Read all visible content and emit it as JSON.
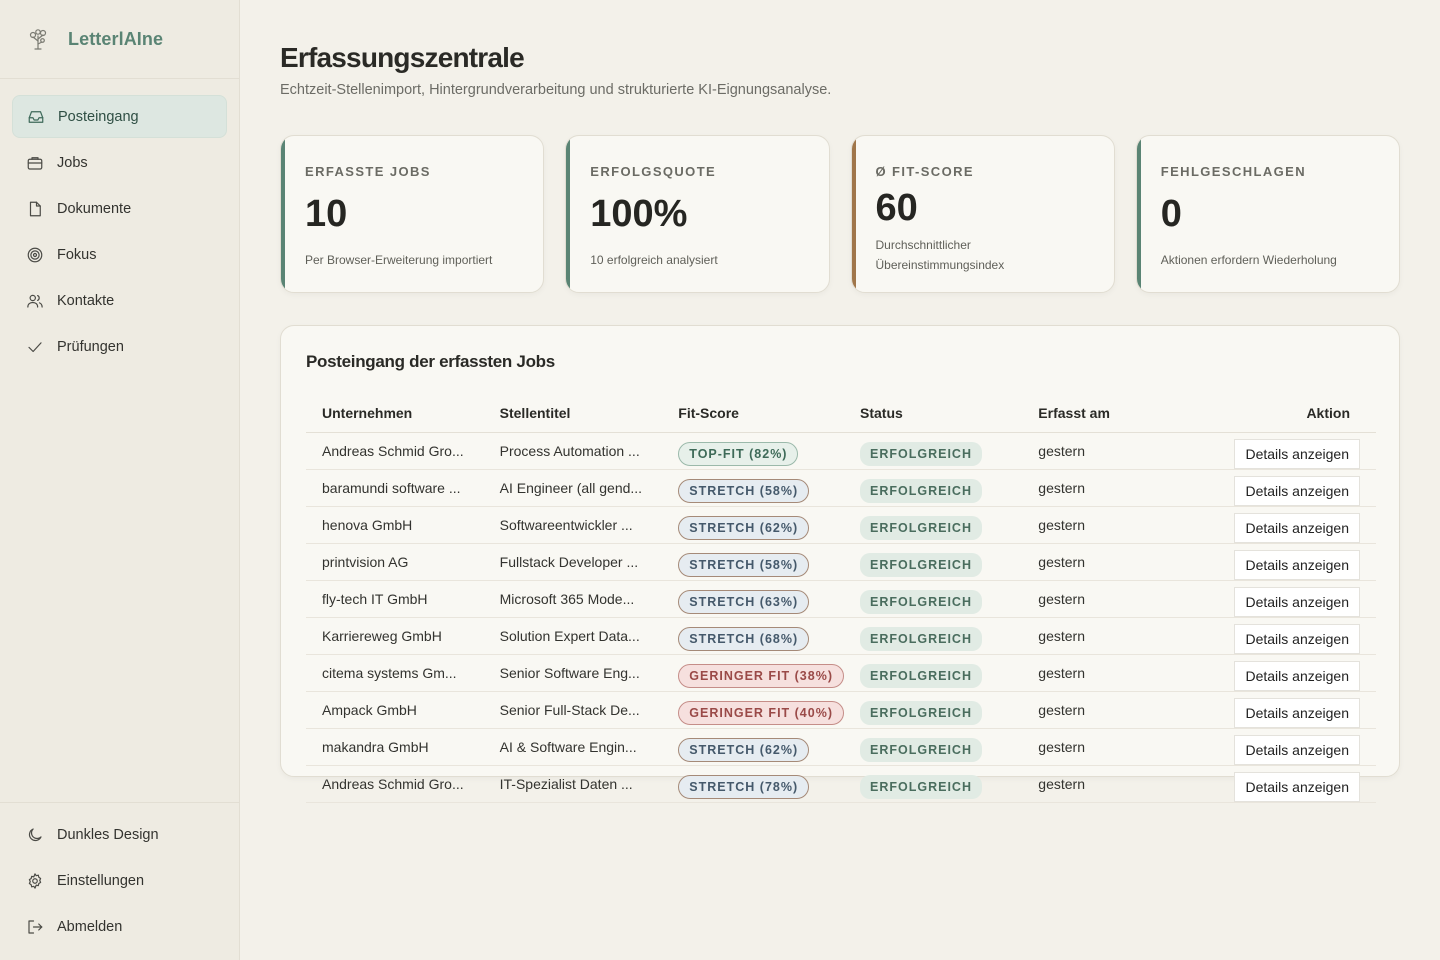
{
  "brand": {
    "name": "LetterlAIne",
    "icon": "tree-logo-icon"
  },
  "nav": {
    "items": [
      {
        "label": "Posteingang",
        "icon": "inbox-icon",
        "active": true
      },
      {
        "label": "Jobs",
        "icon": "briefcase-icon",
        "active": false
      },
      {
        "label": "Dokumente",
        "icon": "document-icon",
        "active": false
      },
      {
        "label": "Fokus",
        "icon": "target-icon",
        "active": false
      },
      {
        "label": "Kontakte",
        "icon": "users-icon",
        "active": false
      },
      {
        "label": "Prüfungen",
        "icon": "check-icon",
        "active": false
      }
    ],
    "bottom": [
      {
        "label": "Dunkles Design",
        "icon": "moon-icon"
      },
      {
        "label": "Einstellungen",
        "icon": "gear-icon"
      },
      {
        "label": "Abmelden",
        "icon": "logout-icon"
      }
    ]
  },
  "header": {
    "title": "Erfassungszentrale",
    "subtitle": "Echtzeit-Stellenimport, Hintergrundverarbeitung und strukturierte KI-Eignungsanalyse."
  },
  "stats": [
    {
      "label": "ERFASSTE JOBS",
      "value": "10",
      "desc": "Per Browser-Erweiterung importiert",
      "accent": "#5a8474"
    },
    {
      "label": "ERFOLGSQUOTE",
      "value": "100%",
      "desc": "10 erfolgreich analysiert",
      "accent": "#5a8474"
    },
    {
      "label": "Ø FIT-SCORE",
      "value": "60",
      "desc1": "Durchschnittlicher",
      "desc2": "Übereinstimmungsindex",
      "accent": "#a0764a"
    },
    {
      "label": "FEHLGESCHLAGEN",
      "value": "0",
      "desc": "Aktionen erfordern Wiederholung",
      "accent": "#5a8474"
    }
  ],
  "table": {
    "title": "Posteingang der erfassten Jobs",
    "columns": [
      "Unternehmen",
      "Stellentitel",
      "Fit-Score",
      "Status",
      "Erfasst am",
      "Aktion"
    ],
    "rows": [
      {
        "company": "Andreas Schmid Gro...",
        "title": "Process Automation ...",
        "fit": "TOP-FIT (82%)",
        "fit_type": "top",
        "status": "ERFOLGREICH",
        "date": "gestern",
        "action": "Details anzeigen"
      },
      {
        "company": "baramundi software ...",
        "title": "AI Engineer (all gend...",
        "fit": "STRETCH (58%)",
        "fit_type": "stretch",
        "status": "ERFOLGREICH",
        "date": "gestern",
        "action": "Details anzeigen"
      },
      {
        "company": "henova GmbH",
        "title": "Softwareentwickler ...",
        "fit": "STRETCH (62%)",
        "fit_type": "stretch",
        "status": "ERFOLGREICH",
        "date": "gestern",
        "action": "Details anzeigen"
      },
      {
        "company": "printvision AG",
        "title": "Fullstack Developer ...",
        "fit": "STRETCH (58%)",
        "fit_type": "stretch",
        "status": "ERFOLGREICH",
        "date": "gestern",
        "action": "Details anzeigen"
      },
      {
        "company": "fly-tech IT GmbH",
        "title": "Microsoft 365 Mode...",
        "fit": "STRETCH (63%)",
        "fit_type": "stretch",
        "status": "ERFOLGREICH",
        "date": "gestern",
        "action": "Details anzeigen"
      },
      {
        "company": "Karriereweg GmbH",
        "title": "Solution Expert Data...",
        "fit": "STRETCH (68%)",
        "fit_type": "stretch",
        "status": "ERFOLGREICH",
        "date": "gestern",
        "action": "Details anzeigen"
      },
      {
        "company": "citema systems Gm...",
        "title": "Senior Software Eng...",
        "fit": "GERINGER FIT (38%)",
        "fit_type": "low",
        "status": "ERFOLGREICH",
        "date": "gestern",
        "action": "Details anzeigen"
      },
      {
        "company": "Ampack GmbH",
        "title": "Senior Full-Stack De...",
        "fit": "GERINGER FIT (40%)",
        "fit_type": "low",
        "status": "ERFOLGREICH",
        "date": "gestern",
        "action": "Details anzeigen"
      },
      {
        "company": "makandra GmbH",
        "title": "AI & Software Engin...",
        "fit": "STRETCH (62%)",
        "fit_type": "stretch",
        "status": "ERFOLGREICH",
        "date": "gestern",
        "action": "Details anzeigen"
      },
      {
        "company": "Andreas Schmid Gro...",
        "title": "IT-Spezialist Daten ...",
        "fit": "STRETCH (78%)",
        "fit_type": "stretch",
        "status": "ERFOLGREICH",
        "date": "gestern",
        "action": "Details anzeigen"
      }
    ]
  }
}
